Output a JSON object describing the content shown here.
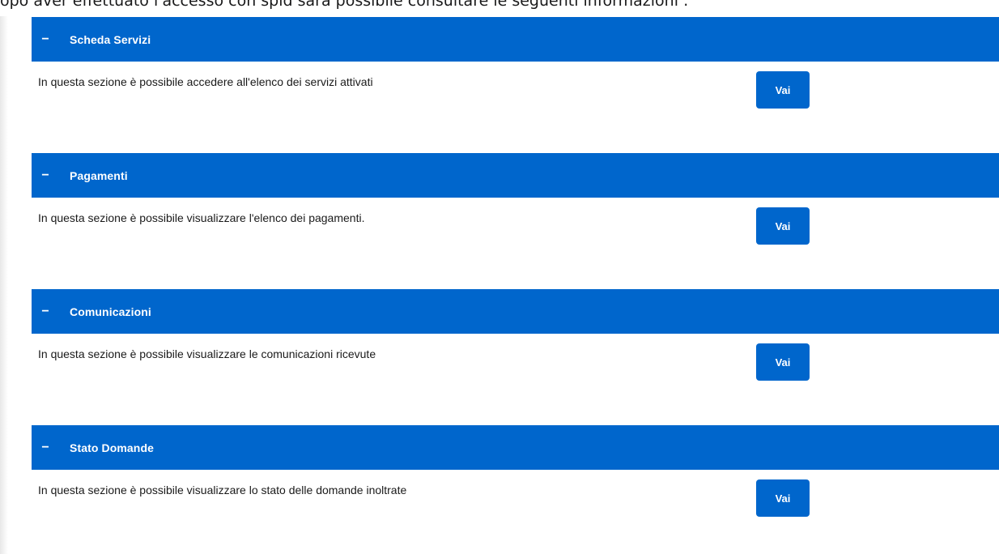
{
  "intro_text": "opo aver effettuato l'accesso con spid sarà possibile consultare le seguenti informazioni :",
  "accent_color": "#0066cc",
  "sections": [
    {
      "title": "Scheda Servizi",
      "collapse_symbol": "−",
      "description": "In questa sezione è possibile accedere all'elenco dei servizi attivati",
      "button_label": "Vai"
    },
    {
      "title": "Pagamenti",
      "collapse_symbol": "−",
      "description": "In questa sezione è possibile visualizzare l'elenco dei pagamenti.",
      "button_label": "Vai"
    },
    {
      "title": "Comunicazioni",
      "collapse_symbol": "−",
      "description": "In questa sezione è possibile visualizzare le comunicazioni ricevute",
      "button_label": "Vai"
    },
    {
      "title": "Stato Domande",
      "collapse_symbol": "−",
      "description": "In questa sezione è possibile visualizzare lo stato delle domande inoltrate",
      "button_label": "Vai"
    }
  ]
}
